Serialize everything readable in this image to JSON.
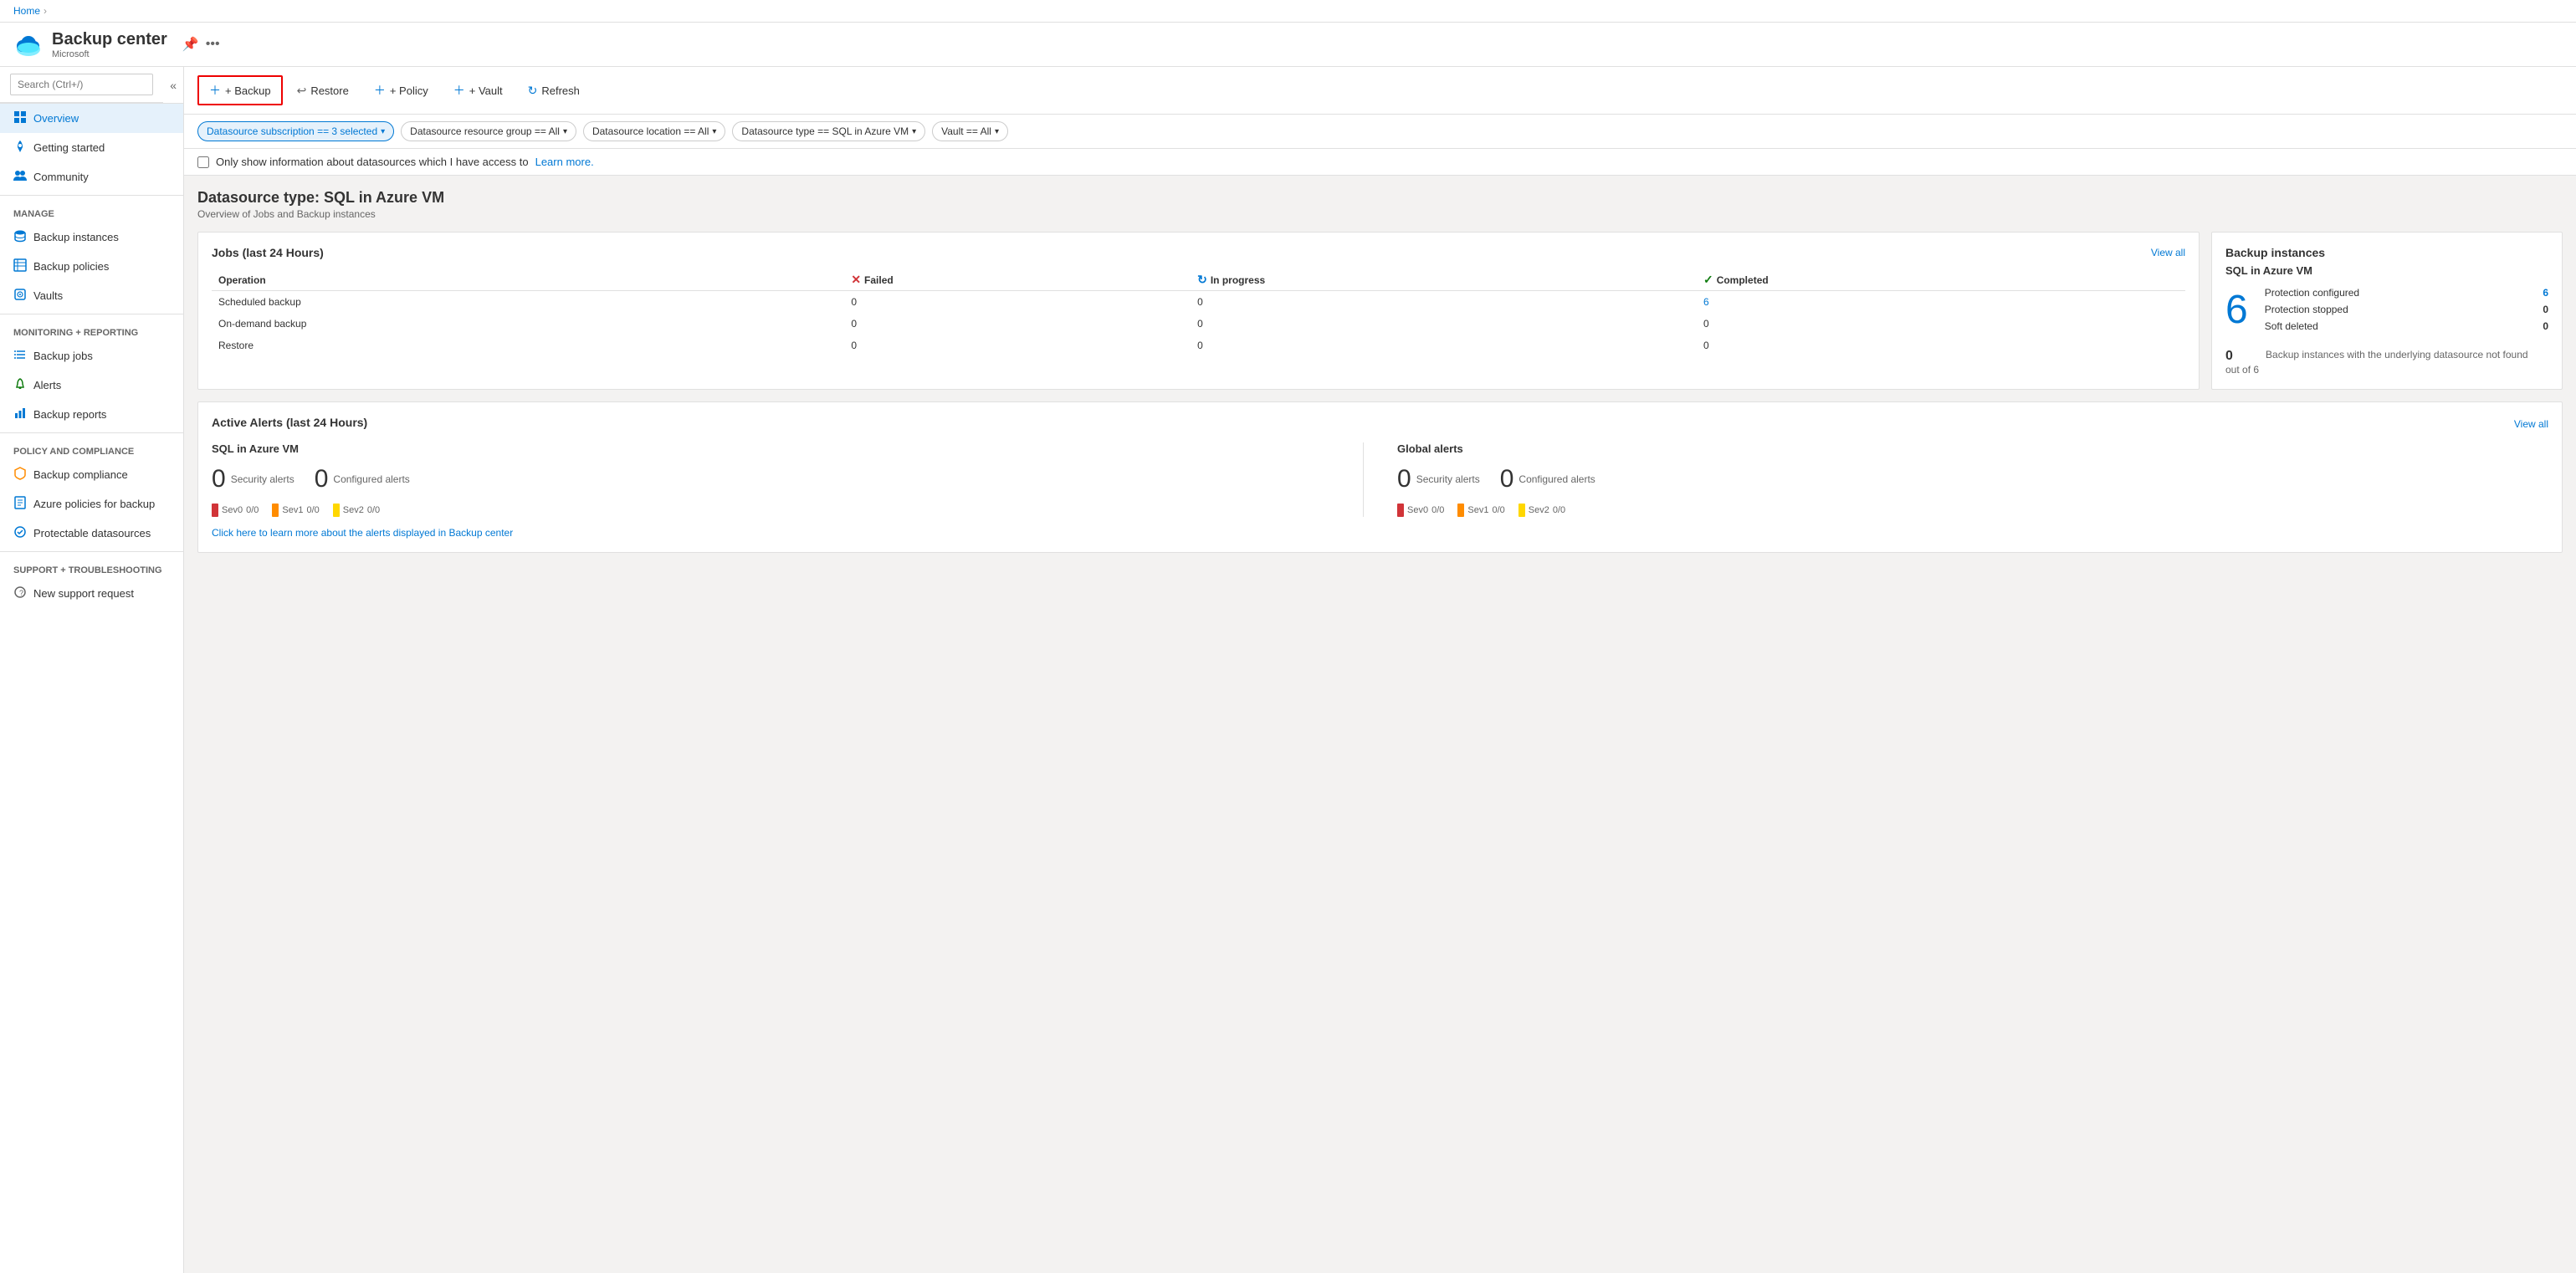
{
  "breadcrumb": {
    "home": "Home",
    "separator": "›"
  },
  "app": {
    "title": "Backup center",
    "subtitle": "Microsoft",
    "pin_title": "Pin",
    "more_title": "More options"
  },
  "sidebar": {
    "search_placeholder": "Search (Ctrl+/)",
    "items": [
      {
        "id": "overview",
        "label": "Overview",
        "active": true,
        "icon": "grid"
      },
      {
        "id": "getting-started",
        "label": "Getting started",
        "active": false,
        "icon": "rocket"
      },
      {
        "id": "community",
        "label": "Community",
        "active": false,
        "icon": "people"
      }
    ],
    "sections": [
      {
        "title": "Manage",
        "items": [
          {
            "id": "backup-instances",
            "label": "Backup instances",
            "icon": "database"
          },
          {
            "id": "backup-policies",
            "label": "Backup policies",
            "icon": "table"
          },
          {
            "id": "vaults",
            "label": "Vaults",
            "icon": "vault"
          }
        ]
      },
      {
        "title": "Monitoring + reporting",
        "items": [
          {
            "id": "backup-jobs",
            "label": "Backup jobs",
            "icon": "list"
          },
          {
            "id": "alerts",
            "label": "Alerts",
            "icon": "bell"
          },
          {
            "id": "backup-reports",
            "label": "Backup reports",
            "icon": "chart"
          }
        ]
      },
      {
        "title": "Policy and compliance",
        "items": [
          {
            "id": "backup-compliance",
            "label": "Backup compliance",
            "icon": "shield"
          },
          {
            "id": "azure-policies",
            "label": "Azure policies for backup",
            "icon": "policy"
          },
          {
            "id": "protectable-datasources",
            "label": "Protectable datasources",
            "icon": "datasource"
          }
        ]
      },
      {
        "title": "Support + troubleshooting",
        "items": [
          {
            "id": "new-support-request",
            "label": "New support request",
            "icon": "support"
          }
        ]
      }
    ]
  },
  "toolbar": {
    "backup_label": "+ Backup",
    "restore_label": "Restore",
    "policy_label": "+ Policy",
    "vault_label": "+ Vault",
    "refresh_label": "Refresh"
  },
  "filters": {
    "subscription": "Datasource subscription == 3 selected",
    "resource_group": "Datasource resource group == All",
    "location": "Datasource location == All",
    "type": "Datasource type == SQL in Azure VM",
    "vault": "Vault == All"
  },
  "access_bar": {
    "checkbox_label": "Only show information about datasources which I have access to",
    "learn_more": "Learn more."
  },
  "datasource": {
    "title": "Datasource type: SQL in Azure VM",
    "subtitle": "Overview of Jobs and Backup instances"
  },
  "jobs_card": {
    "title": "Jobs (last 24 Hours)",
    "view_all": "View all",
    "headers": {
      "operation": "Operation",
      "failed": "Failed",
      "in_progress": "In progress",
      "completed": "Completed"
    },
    "rows": [
      {
        "operation": "Scheduled backup",
        "failed": "0",
        "in_progress": "0",
        "completed": "6",
        "completed_linked": true
      },
      {
        "operation": "On-demand backup",
        "failed": "0",
        "in_progress": "0",
        "completed": "0"
      },
      {
        "operation": "Restore",
        "failed": "0",
        "in_progress": "0",
        "completed": "0"
      }
    ]
  },
  "backup_instances_card": {
    "title": "Backup instances",
    "type": "SQL in Azure VM",
    "count": "6",
    "protection_configured_label": "Protection configured",
    "protection_configured_value": "6",
    "protection_stopped_label": "Protection stopped",
    "protection_stopped_value": "0",
    "soft_deleted_label": "Soft deleted",
    "soft_deleted_value": "0",
    "footer_count": "0",
    "footer_out_of": "out of 6",
    "footer_desc": "Backup instances with the underlying datasource not found"
  },
  "alerts_card": {
    "title": "Active Alerts (last 24 Hours)",
    "view_all": "View all",
    "sql_section": {
      "title": "SQL in Azure VM",
      "security_count": "0",
      "security_label": "Security alerts",
      "configured_count": "0",
      "configured_label": "Configured alerts",
      "sev0_label": "Sev0",
      "sev0_value": "0/0",
      "sev1_label": "Sev1",
      "sev1_value": "0/0",
      "sev2_label": "Sev2",
      "sev2_value": "0/0"
    },
    "global_section": {
      "title": "Global alerts",
      "security_count": "0",
      "security_label": "Security alerts",
      "configured_count": "0",
      "configured_label": "Configured alerts",
      "sev0_label": "Sev0",
      "sev0_value": "0/0",
      "sev1_label": "Sev1",
      "sev1_value": "0/0",
      "sev2_label": "Sev2",
      "sev2_value": "0/0"
    },
    "learn_more_text": "Click here to learn more about the alerts displayed in Backup center"
  }
}
